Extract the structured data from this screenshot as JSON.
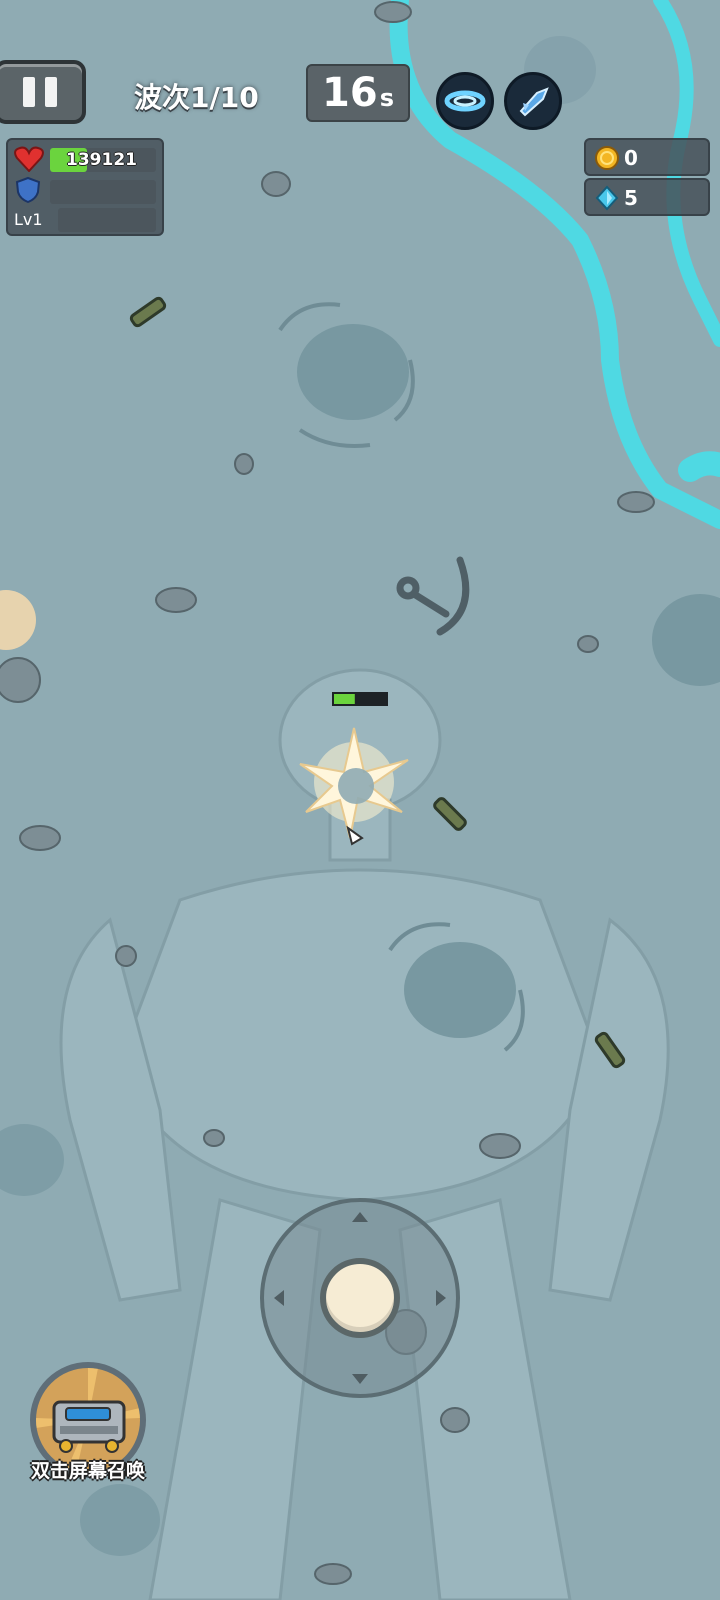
{
  "hud": {
    "wave_label": "波次1/10",
    "timer": {
      "value": "16",
      "unit": "s"
    },
    "hp_value": "139121",
    "hp_fraction": 0.35,
    "shield_fraction": 0,
    "xp_fraction": 0,
    "level_label": "Lv1",
    "gold_count": "0",
    "gem_count": "5",
    "skills": [
      "vortex-skill-icon",
      "rocket-skill-icon"
    ]
  },
  "player": {
    "health_fraction": 0.4
  },
  "summon": {
    "label": "双击屏幕召唤",
    "icon": "robot-machine-icon"
  },
  "colors": {
    "ground": "#8fabb3",
    "river": "#4fd9e3",
    "hp_bar": "#6bd43e",
    "shield": "#3e72c7",
    "gold": "#f3b623",
    "gem": "#49c7ea"
  }
}
